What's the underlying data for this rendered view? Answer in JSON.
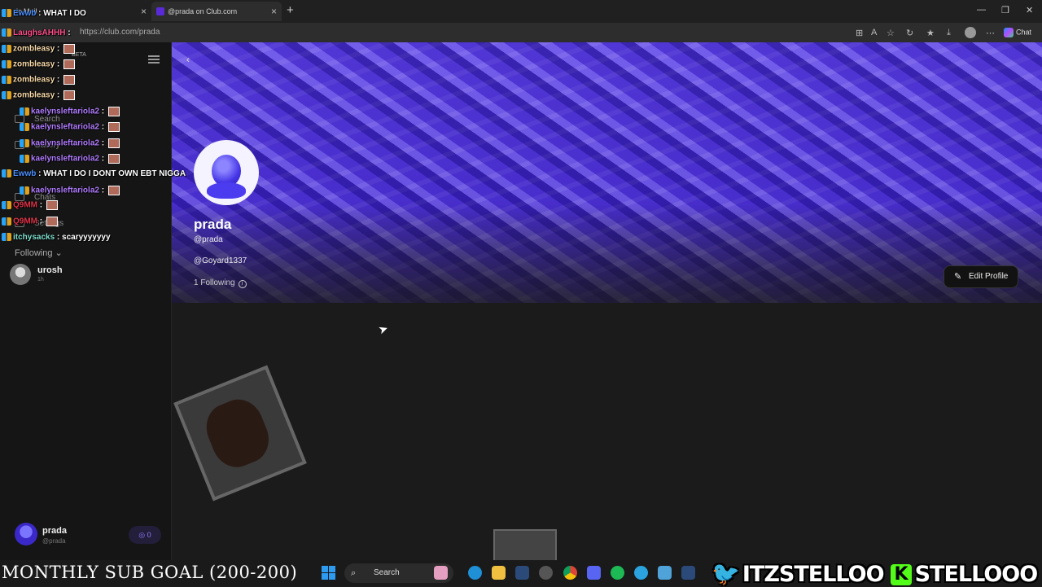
{
  "browser": {
    "tabs": [
      {
        "label": "ic Mail"
      },
      {
        "label": "@prada on Club.com"
      }
    ],
    "url": "https://club.com/prada",
    "copilot_label": "Chat"
  },
  "sidebar": {
    "beta": "BETA",
    "nav": [
      {
        "label": "Search"
      },
      {
        "label": "Gallery"
      },
      {
        "label": "Chats"
      },
      {
        "label": "Settings"
      }
    ],
    "following_header": "Following",
    "following": [
      {
        "name": "urosh",
        "time": "1h"
      }
    ],
    "me": {
      "name": "prada",
      "handle": "@prada",
      "badge_count": "0"
    }
  },
  "profile": {
    "display_name": "prada",
    "handle": "@prada",
    "bio": "@Goyard1337",
    "following_count": "1 Following",
    "edit_button": "Edit Profile",
    "back_icon": "chevron-left-icon"
  },
  "chat": [
    {
      "user": "Ewwb",
      "color": "#4a90ff",
      "msg": "WHAT I DO",
      "emote": false
    },
    {
      "user": "LaughsAHHH",
      "color": "#ff4f8b",
      "msg": "",
      "emote": false
    },
    {
      "user": "zombleasy",
      "color": "#f6d9a8",
      "msg": "",
      "emote": true
    },
    {
      "user": "zombleasy",
      "color": "#f6d9a8",
      "msg": "",
      "emote": true
    },
    {
      "user": "zombleasy",
      "color": "#f6d9a8",
      "msg": "",
      "emote": true
    },
    {
      "user": "zombleasy",
      "color": "#f6d9a8",
      "msg": "",
      "emote": true
    },
    {
      "user": "kaelynsleftariola2",
      "color": "#b07cff",
      "msg": "",
      "emote": true
    },
    {
      "user": "kaelynsleftariola2",
      "color": "#b07cff",
      "msg": "",
      "emote": true
    },
    {
      "user": "kaelynsleftariola2",
      "color": "#b07cff",
      "msg": "",
      "emote": true
    },
    {
      "user": "kaelynsleftariola2",
      "color": "#b07cff",
      "msg": "",
      "emote": true
    },
    {
      "user": "Ewwb",
      "color": "#4a90ff",
      "msg": "WHAT I DO I DONT OWN EBT NIGGA",
      "emote": false
    },
    {
      "user": "kaelynsleftariola2",
      "color": "#b07cff",
      "msg": "",
      "emote": true
    },
    {
      "user": "Q9MM",
      "color": "#e0334a",
      "msg": "",
      "emote": true
    },
    {
      "user": "Q9MM",
      "color": "#e0334a",
      "msg": "",
      "emote": true
    },
    {
      "user": "itchysacks",
      "color": "#7fe0d0",
      "msg": "scaryyyyyyy",
      "emote": false
    }
  ],
  "stream": {
    "sub_goal": "MONTHLY SUB GOAL (200-200)",
    "twitter_handle": "ITZSTELLOO",
    "kick_handle": "STELLOOO",
    "kick_letter": "K"
  },
  "taskbar": {
    "search_label": "Search",
    "apps": [
      "tulips-icon",
      "edge-icon",
      "explorer-icon",
      "steam-icon",
      "settings-icon",
      "chrome-icon",
      "discord-icon",
      "spotify-icon",
      "telegram-icon",
      "notepad-icon",
      "steam-icon"
    ]
  },
  "colors": {
    "accent": "#4b3cf0",
    "twitter": "#1da1f2",
    "kick": "#53fc18"
  }
}
